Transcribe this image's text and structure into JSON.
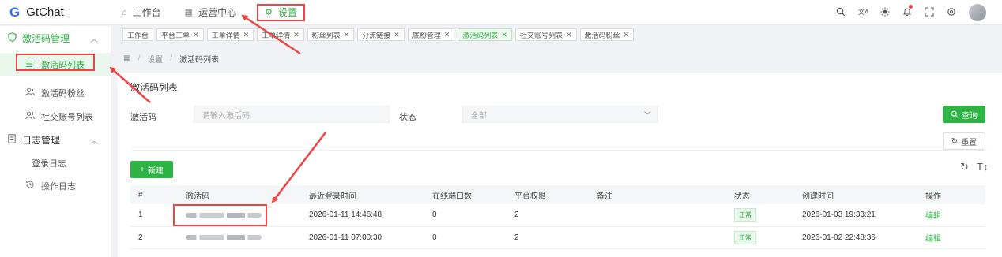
{
  "app": {
    "logo_letter": "G",
    "title": "GtChat"
  },
  "topnav": [
    {
      "icon": "home-icon",
      "glyph": "⌂",
      "label": "工作台"
    },
    {
      "icon": "grid-icon",
      "glyph": "▦",
      "label": "运营中心"
    },
    {
      "icon": "gear-icon",
      "glyph": "⚙",
      "label": "设置"
    }
  ],
  "topright_icons": [
    "search-icon",
    "translate-icon",
    "theme-icon",
    "bell-icon",
    "fullscreen-icon",
    "settings-icon"
  ],
  "sidebar": {
    "group1": {
      "label": "激活码管理"
    },
    "items1": [
      {
        "label": "激活码列表"
      },
      {
        "label": "激活码粉丝"
      },
      {
        "label": "社交账号列表"
      }
    ],
    "group2": {
      "label": "日志管理"
    },
    "items2": [
      {
        "label": "登录日志"
      },
      {
        "label": "操作日志"
      }
    ]
  },
  "tabs": [
    {
      "label": "工作台",
      "closable": false
    },
    {
      "label": "平台工单",
      "closable": true
    },
    {
      "label": "工单详情",
      "closable": true
    },
    {
      "label": "工单详情",
      "closable": true
    },
    {
      "label": "粉丝列表",
      "closable": true
    },
    {
      "label": "分流链接",
      "closable": true
    },
    {
      "label": "底粉管理",
      "closable": true
    },
    {
      "label": "激活码列表",
      "closable": true,
      "active": true
    },
    {
      "label": "社交账号列表",
      "closable": true
    },
    {
      "label": "激活码粉丝",
      "closable": true
    }
  ],
  "breadcrumb": {
    "home_icon": "▦",
    "level1": "设置",
    "level2": "激活码列表",
    "sep": "/"
  },
  "page": {
    "title": "激活码列表",
    "filter": {
      "code_label": "激活码",
      "code_placeholder": "请输入激活码",
      "status_label": "状态",
      "status_value": "全部"
    },
    "query_button": "查询",
    "reset_button": "重置",
    "new_button": "新建"
  },
  "table": {
    "columns": [
      "#",
      "激活码",
      "最近登录时间",
      "在线端口数",
      "平台权限",
      "备注",
      "状态",
      "创建时间",
      "操作"
    ],
    "rows": [
      {
        "idx": "1",
        "last_login": "2026-01-11 14:46:48",
        "online": "0",
        "perm": "2",
        "note": "",
        "status": "正常",
        "created": "2026-01-03 19:33:21",
        "action": "编辑"
      },
      {
        "idx": "2",
        "last_login": "2026-01-11 07:00:30",
        "online": "0",
        "perm": "2",
        "note": "",
        "status": "正常",
        "created": "2026-01-02 22:48:36",
        "action": "编辑"
      }
    ]
  },
  "colors": {
    "accent": "#2fb344",
    "annotation": "#ef4444",
    "brand": "#2f6bff"
  }
}
